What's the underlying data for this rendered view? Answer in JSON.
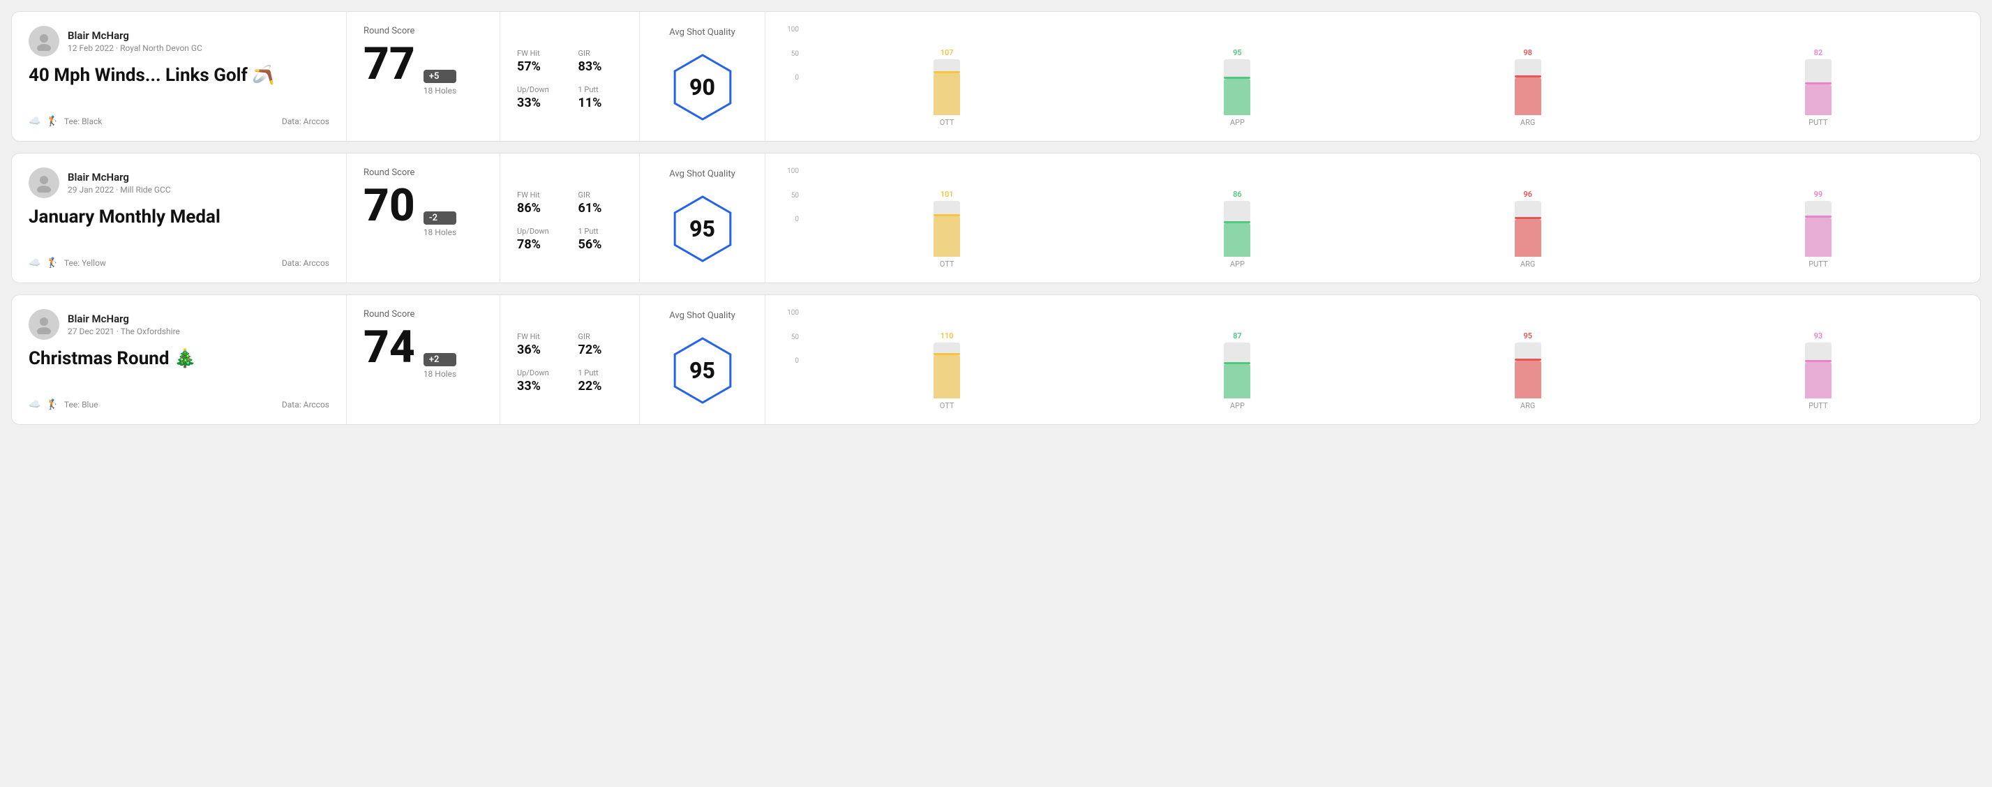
{
  "rounds": [
    {
      "id": "round1",
      "user": {
        "name": "Blair McHarg",
        "date": "12 Feb 2022",
        "course": "Royal North Devon GC"
      },
      "title": "40 Mph Winds... Links Golf",
      "title_emoji": "🪃",
      "tee": "Black",
      "data_source": "Data: Arccos",
      "score": {
        "value": "77",
        "badge": "+5",
        "badge_type": "over",
        "holes": "18 Holes"
      },
      "stats": {
        "fw_hit_label": "FW Hit",
        "fw_hit_value": "57%",
        "gir_label": "GIR",
        "gir_value": "83%",
        "updown_label": "Up/Down",
        "updown_value": "33%",
        "oneputt_label": "1 Putt",
        "oneputt_value": "11%"
      },
      "quality": {
        "label": "Avg Shot Quality",
        "score": "90"
      },
      "chart": {
        "y_labels": [
          "100",
          "50",
          "0"
        ],
        "bars": [
          {
            "label": "OTT",
            "value": 107,
            "color": "#f5c542",
            "fill_pct": 75
          },
          {
            "label": "APP",
            "value": 95,
            "color": "#4fc97f",
            "fill_pct": 65
          },
          {
            "label": "ARG",
            "value": 98,
            "color": "#e85555",
            "fill_pct": 68
          },
          {
            "label": "PUTT",
            "value": 82,
            "color": "#e885c7",
            "fill_pct": 55
          }
        ]
      }
    },
    {
      "id": "round2",
      "user": {
        "name": "Blair McHarg",
        "date": "29 Jan 2022",
        "course": "Mill Ride GCC"
      },
      "title": "January Monthly Medal",
      "title_emoji": "",
      "tee": "Yellow",
      "data_source": "Data: Arccos",
      "score": {
        "value": "70",
        "badge": "-2",
        "badge_type": "under",
        "holes": "18 Holes"
      },
      "stats": {
        "fw_hit_label": "FW Hit",
        "fw_hit_value": "86%",
        "gir_label": "GIR",
        "gir_value": "61%",
        "updown_label": "Up/Down",
        "updown_value": "78%",
        "oneputt_label": "1 Putt",
        "oneputt_value": "56%"
      },
      "quality": {
        "label": "Avg Shot Quality",
        "score": "95"
      },
      "chart": {
        "y_labels": [
          "100",
          "50",
          "0"
        ],
        "bars": [
          {
            "label": "OTT",
            "value": 101,
            "color": "#f5c542",
            "fill_pct": 72
          },
          {
            "label": "APP",
            "value": 86,
            "color": "#4fc97f",
            "fill_pct": 60
          },
          {
            "label": "ARG",
            "value": 96,
            "color": "#e85555",
            "fill_pct": 67
          },
          {
            "label": "PUTT",
            "value": 99,
            "color": "#e885c7",
            "fill_pct": 70
          }
        ]
      }
    },
    {
      "id": "round3",
      "user": {
        "name": "Blair McHarg",
        "date": "27 Dec 2021",
        "course": "The Oxfordshire"
      },
      "title": "Christmas Round",
      "title_emoji": "🎄",
      "tee": "Blue",
      "data_source": "Data: Arccos",
      "score": {
        "value": "74",
        "badge": "+2",
        "badge_type": "over",
        "holes": "18 Holes"
      },
      "stats": {
        "fw_hit_label": "FW Hit",
        "fw_hit_value": "36%",
        "gir_label": "GIR",
        "gir_value": "72%",
        "updown_label": "Up/Down",
        "updown_value": "33%",
        "oneputt_label": "1 Putt",
        "oneputt_value": "22%"
      },
      "quality": {
        "label": "Avg Shot Quality",
        "score": "95"
      },
      "chart": {
        "y_labels": [
          "100",
          "50",
          "0"
        ],
        "bars": [
          {
            "label": "OTT",
            "value": 110,
            "color": "#f5c542",
            "fill_pct": 78
          },
          {
            "label": "APP",
            "value": 87,
            "color": "#4fc97f",
            "fill_pct": 61
          },
          {
            "label": "ARG",
            "value": 95,
            "color": "#e85555",
            "fill_pct": 67
          },
          {
            "label": "PUTT",
            "value": 93,
            "color": "#e885c7",
            "fill_pct": 65
          }
        ]
      }
    }
  ],
  "labels": {
    "round_score": "Round Score",
    "avg_shot_quality": "Avg Shot Quality"
  }
}
